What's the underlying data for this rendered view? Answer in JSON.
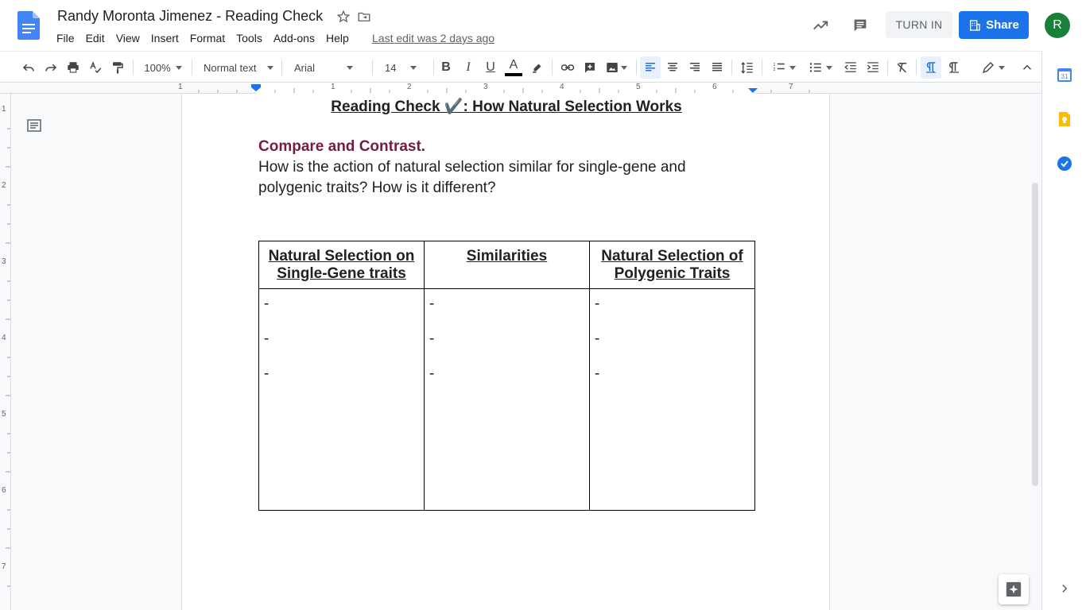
{
  "doc": {
    "title": "Randy Moronta Jimenez - Reading Check",
    "last_edit": "Last edit was 2 days ago"
  },
  "menu": [
    "File",
    "Edit",
    "View",
    "Insert",
    "Format",
    "Tools",
    "Add-ons",
    "Help"
  ],
  "header": {
    "turn_in": "TURN IN",
    "share": "Share",
    "avatar_initial": "R"
  },
  "toolbar": {
    "zoom": "100%",
    "style": "Normal text",
    "font": "Arial",
    "size": "14"
  },
  "ruler": {
    "h_numbers": [
      "1",
      "1",
      "2",
      "3",
      "4",
      "5",
      "6",
      "7"
    ],
    "v_numbers": [
      "1",
      "2",
      "3",
      "4",
      "5",
      "6",
      "7"
    ]
  },
  "content": {
    "heading": "Reading Check ✔️: How Natural Selection Works",
    "section_title": "Compare and Contrast.",
    "question": "How is the action of natural selection similar for single-gene and polygenic traits?  How is it different?",
    "table": {
      "headers": [
        "Natural Selection on Single-Gene traits",
        "Similarities",
        "Natural Selection of Polygenic Traits"
      ],
      "rows": [
        [
          "-",
          "-",
          "-"
        ],
        [
          "-",
          "-",
          "-"
        ],
        [
          "-",
          "-",
          "-"
        ]
      ]
    }
  },
  "colors": {
    "accent": "#1a73e8",
    "avatar": "#188038",
    "section_title": "#741b47"
  }
}
